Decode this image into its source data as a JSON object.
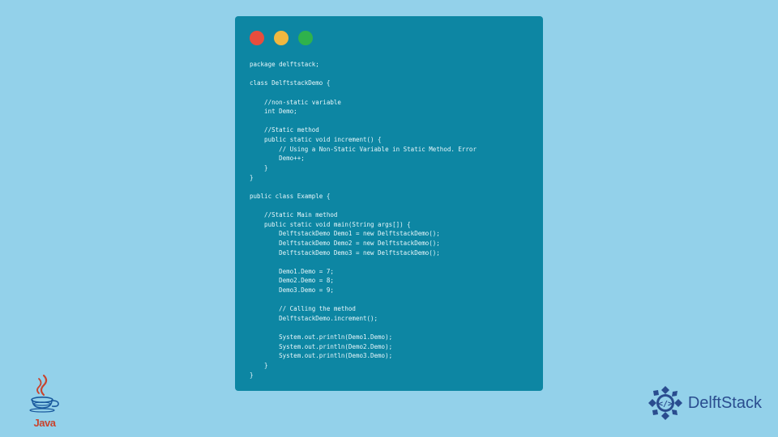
{
  "code_window": {
    "lines": "package delftstack;\n\nclass DelftstackDemo {\n\n    //non-static variable\n    int Demo;\n\n    //Static method\n    public static void increment() {\n        // Using a Non-Static Variable in Static Method. Error\n        Demo++;\n    }\n}\n\npublic class Example {\n\n    //Static Main method\n    public static void main(String args[]) {\n        DelftstackDemo Demo1 = new DelftstackDemo();\n        DelftstackDemo Demo2 = new DelftstackDemo();\n        DelftstackDemo Demo3 = new DelftstackDemo();\n\n        Demo1.Demo = 7;\n        Demo2.Demo = 8;\n        Demo3.Demo = 9;\n\n        // Calling the method\n        DelftstackDemo.increment();\n\n        System.out.println(Demo1.Demo);\n        System.out.println(Demo2.Demo);\n        System.out.println(Demo3.Demo);\n    }\n}"
  },
  "java_logo": {
    "text": "Java"
  },
  "delftstack_logo": {
    "text": "DelftStack"
  },
  "colors": {
    "background": "#93d1ea",
    "window_bg": "#0d86a3",
    "dot_red": "#e84d3d",
    "dot_yellow": "#f0b840",
    "dot_green": "#2fb24c",
    "java_accent": "#c8442e",
    "ds_accent": "#2a4d8f"
  }
}
